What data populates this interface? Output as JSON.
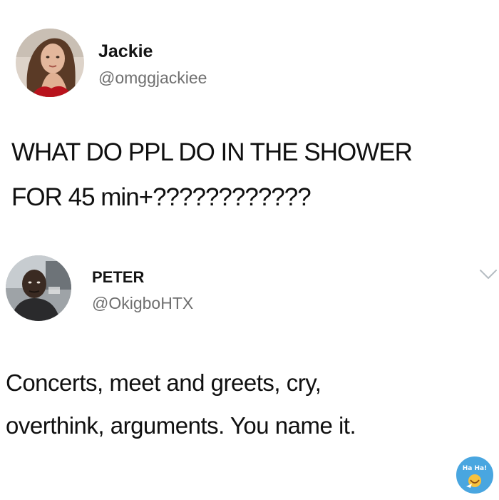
{
  "tweets": [
    {
      "name": "Jackie",
      "handle": "@omggjackiee",
      "text_lines": [
        "WHAT DO PPL DO IN THE SHOWER",
        "FOR 45 min+????????????"
      ]
    },
    {
      "name": "PETER",
      "handle": "@OkigboHTX",
      "text_lines": [
        "Concerts, meet and greets, cry,",
        "overthink, arguments. You name it."
      ]
    }
  ],
  "watermark": {
    "text": "Ha Ha!",
    "icon": "haha-logo"
  },
  "icons": {
    "menu": "chevron-down-icon"
  },
  "colors": {
    "handle_gray": "#6f6f6f",
    "watermark_blue": "#49a6e0"
  }
}
